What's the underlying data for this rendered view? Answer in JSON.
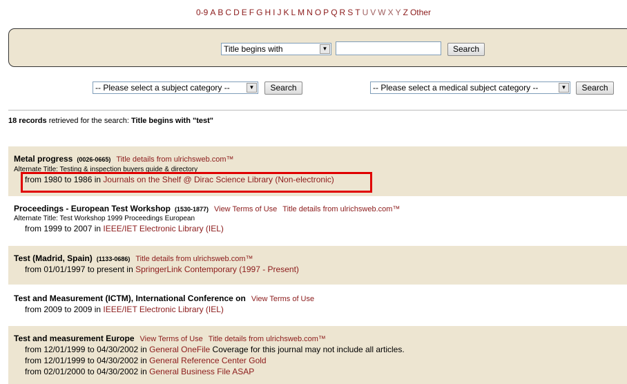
{
  "alphabet": [
    "0-9",
    "A",
    "B",
    "C",
    "D",
    "E",
    "F",
    "G",
    "H",
    "I",
    "J",
    "K",
    "L",
    "M",
    "N",
    "O",
    "P",
    "Q",
    "R",
    "S",
    "T",
    "U",
    "V",
    "W",
    "X",
    "Y",
    "Z",
    "Other"
  ],
  "search": {
    "type_selected": "Title begins with",
    "query_value": "",
    "button_label": "Search"
  },
  "subject": {
    "select_label": "-- Please select a subject category --",
    "button_label": "Search"
  },
  "medical": {
    "select_label": "-- Please select a medical subject category --",
    "button_label": "Search"
  },
  "results_summary": {
    "count_text": "18 records",
    "middle_text": "retrieved for the search:",
    "query_text": "Title begins with \"test\""
  },
  "records": [
    {
      "title": "Metal progress",
      "issn": "(0026-0665)",
      "links": [
        "Title details from ulrichsweb.com™"
      ],
      "alt_title": "Alternate Title: Testing & inspection buyers guide & directory",
      "holdings": [
        {
          "from_text": "from 1980 to 1986 in",
          "link": "Journals on the Shelf @ Dirac Science Library (Non-electronic)",
          "note": ""
        }
      ]
    },
    {
      "title": "Proceedings - European Test Workshop",
      "issn": "(1530-1877)",
      "links": [
        "View Terms of Use",
        "Title details from ulrichsweb.com™"
      ],
      "alt_title": "Alternate Title: Test Workshop 1999 Proceedings European",
      "holdings": [
        {
          "from_text": "from 1999 to 2007 in",
          "link": "IEEE/IET Electronic Library (IEL)",
          "note": ""
        }
      ]
    },
    {
      "title": "Test (Madrid, Spain)",
      "issn": "(1133-0686)",
      "links": [
        "Title details from ulrichsweb.com™"
      ],
      "alt_title": "",
      "holdings": [
        {
          "from_text": "from 01/01/1997 to present in",
          "link": "SpringerLink Contemporary (1997 - Present)",
          "note": ""
        }
      ]
    },
    {
      "title": "Test and Measurement (ICTM), International Conference on",
      "issn": "",
      "links": [
        "View Terms of Use"
      ],
      "alt_title": "",
      "holdings": [
        {
          "from_text": "from 2009 to 2009 in",
          "link": "IEEE/IET Electronic Library (IEL)",
          "note": ""
        }
      ]
    },
    {
      "title": "Test and measurement Europe",
      "issn": "",
      "links": [
        "View Terms of Use",
        "Title details from ulrichsweb.com™"
      ],
      "alt_title": "",
      "holdings": [
        {
          "from_text": "from 12/01/1999 to 04/30/2002 in",
          "link": "General OneFile",
          "note": "Coverage for this journal may not include all articles."
        },
        {
          "from_text": "from 12/01/1999 to 04/30/2002 in",
          "link": "General Reference Center Gold",
          "note": ""
        },
        {
          "from_text": "from 02/01/2000 to 04/30/2002 in",
          "link": "General Business File ASAP",
          "note": ""
        }
      ]
    }
  ],
  "colors": {
    "link": "#8b1a1a",
    "shade": "#ede5d1",
    "highlight": "#e00000"
  }
}
